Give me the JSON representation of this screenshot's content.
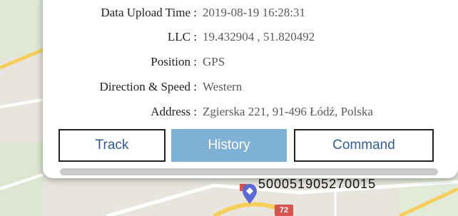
{
  "info": {
    "rows": [
      {
        "label": "Data Upload Time :",
        "value": "2019-08-19 16:28:31"
      },
      {
        "label": "LLC :",
        "value": "19.432904 , 51.820492"
      },
      {
        "label": "Position :",
        "value": "GPS"
      },
      {
        "label": "Direction & Speed :",
        "value": "Western"
      },
      {
        "label": "Address :",
        "value": "Zgierska 221, 91-496 Łódź, Polska"
      }
    ]
  },
  "buttons": {
    "track": "Track",
    "history": "History",
    "command": "Command"
  },
  "map": {
    "device_id": "500051905270015",
    "road_number": "72",
    "colors": {
      "background": "#e9e6df",
      "road_yellow": "#f6cf5a",
      "marker": "#5b6bd6",
      "badge": "#d9534f"
    }
  }
}
